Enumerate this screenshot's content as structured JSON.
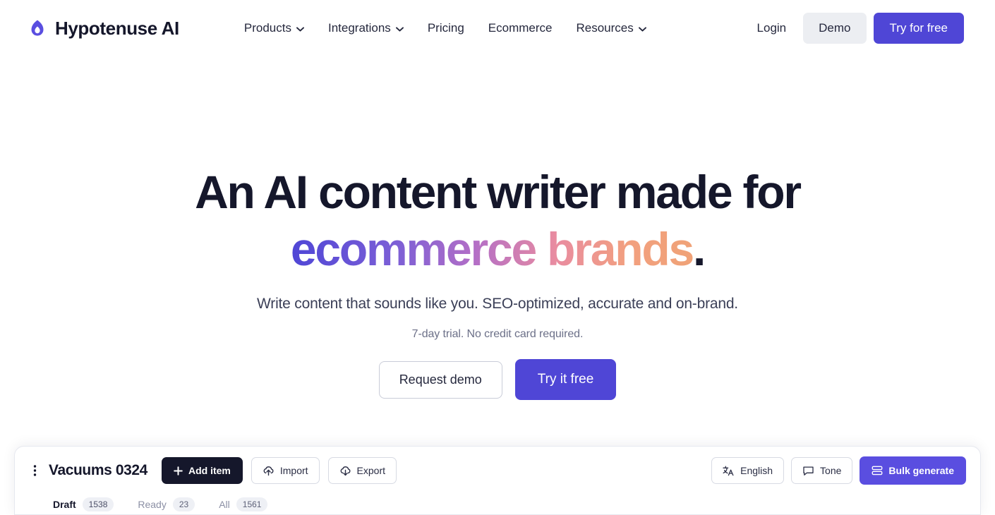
{
  "brand": {
    "name": "Hypotenuse AI",
    "logo_icon": "hypotenuse-logo-icon",
    "logo_color": "#5a4ee0"
  },
  "nav": {
    "links": [
      {
        "label": "Products",
        "has_caret": true,
        "icon": "chevron-down-icon"
      },
      {
        "label": "Integrations",
        "has_caret": true,
        "icon": "chevron-down-icon"
      },
      {
        "label": "Pricing",
        "has_caret": false
      },
      {
        "label": "Ecommerce",
        "has_caret": false
      },
      {
        "label": "Resources",
        "has_caret": true,
        "icon": "chevron-down-icon"
      }
    ],
    "login_label": "Login",
    "demo_label": "Demo",
    "try_label": "Try for free",
    "accent_color": "#4f46d6",
    "demo_bg": "#eceef2"
  },
  "hero": {
    "title_line1": "An AI content writer made for",
    "title_line2_gradient": "ecommerce brands",
    "title_period": ".",
    "subtitle": "Write content that sounds like you. SEO-optimized, accurate and on-brand.",
    "note": "7-day trial. No credit card required.",
    "cta_secondary": "Request demo",
    "cta_primary": "Try it free",
    "gradient_colors": [
      "#4f46d6",
      "#b46fc6",
      "#e98ca0",
      "#f0a277"
    ]
  },
  "app_preview": {
    "menu_icon": "vertical-dots-icon",
    "title": "Vacuums 0324",
    "buttons": [
      {
        "label": "Add item",
        "icon": "plus-icon",
        "style": "dark"
      },
      {
        "label": "Import",
        "icon": "cloud-upload-icon",
        "style": "ghost"
      },
      {
        "label": "Export",
        "icon": "cloud-download-icon",
        "style": "ghost"
      }
    ],
    "right_buttons": [
      {
        "label": "English",
        "icon": "translate-icon",
        "style": "ghost"
      },
      {
        "label": "Tone",
        "icon": "chat-bubble-icon",
        "style": "ghost"
      },
      {
        "label": "Bulk generate",
        "icon": "stack-icon",
        "style": "purple"
      }
    ],
    "tabs": [
      {
        "label": "Draft",
        "count": "1538",
        "active": true
      },
      {
        "label": "Ready",
        "count": "23",
        "active": false
      },
      {
        "label": "All",
        "count": "1561",
        "active": false
      }
    ]
  }
}
